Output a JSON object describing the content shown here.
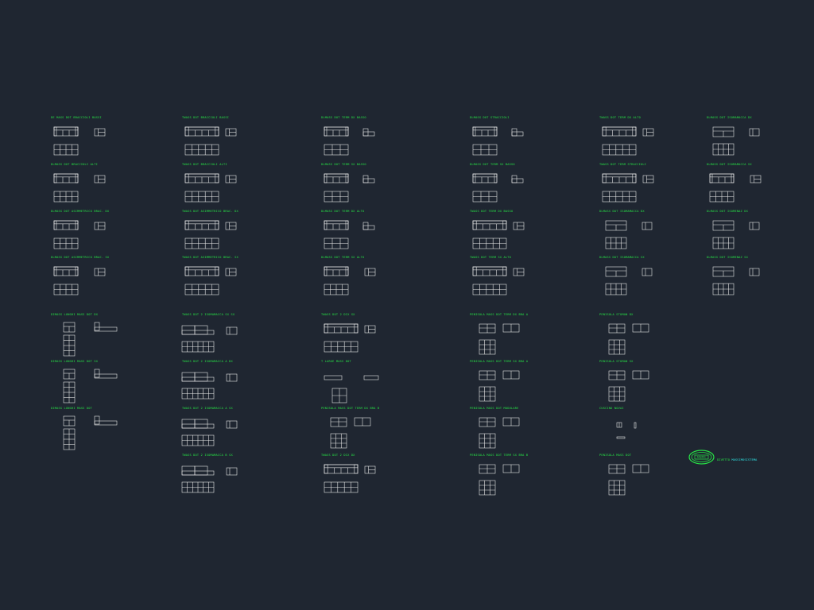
{
  "colors": {
    "background": "#1f2631",
    "label": "#27e646",
    "line": "#e6e6e6",
    "accent": "#2ee0e0"
  },
  "blocks": [
    {
      "label": "DE MASS DOT BRACCIOLI BASSI",
      "kind": "sofa"
    },
    {
      "label": "TWASS DOT BRACCIOLI BASSI",
      "kind": "sofa-wide"
    },
    {
      "label": "DLMASS DOT TERM DX BASSO",
      "kind": "sofa-end"
    },
    {
      "label": "DLMASS DOT STRACCIOLI",
      "kind": "sofa-end"
    },
    {
      "label": "TWASS DOT TERM DX ALTO",
      "kind": "sofa-wide"
    },
    {
      "label": "DLMASS DOT ISOMAMACCA DX",
      "kind": "corner"
    },
    {
      "label": "DLMASS DOT BRACCIOLI ALTI",
      "kind": "sofa"
    },
    {
      "label": "TWASS DOT BRACCIOLI ALTI",
      "kind": "sofa-wide"
    },
    {
      "label": "DLMASS DOT TERM SX BASSO",
      "kind": "sofa-end"
    },
    {
      "label": "DLMASS DOT TERM SX BASSO",
      "kind": "sofa-end"
    },
    {
      "label": "TWASS DOT TERM STRACCIOLI",
      "kind": "sofa-wide"
    },
    {
      "label": "DLMASS DOT ISOMAMACCA SX",
      "kind": "sofa"
    },
    {
      "label": "DLMASS DOT ASIMMETRICO BRAC. DX",
      "kind": "sofa"
    },
    {
      "label": "TWASS DOT ASIMMETRICO BRAC. DX",
      "kind": "sofa-wide"
    },
    {
      "label": "DLMASS DOT TERM DX ALTO",
      "kind": "sofa-end"
    },
    {
      "label": "TWASS DOT TERM DX BASSO",
      "kind": "sofa-wide"
    },
    {
      "label": "DLMASS DOT ISOMAMACCA DX",
      "kind": "corner"
    },
    {
      "label": "DLMASS DOT ISOMENAZ DX",
      "kind": "corner"
    },
    {
      "label": "DLMASS DOT ASIMMETRICO BRAC. SX",
      "kind": "sofa"
    },
    {
      "label": "TWASS DOT ASIMMETRICO BRAC. SX",
      "kind": "sofa-wide"
    },
    {
      "label": "DLMASS DOT TERM SX ALTO",
      "kind": "sofa"
    },
    {
      "label": "TWASS DOT TERM SX ALTO",
      "kind": "sofa-wide"
    },
    {
      "label": "DLMASS DOT ISOMAMACCA SX",
      "kind": "corner"
    },
    {
      "label": "DLMASS DOT ISOMENAZ SX",
      "kind": "corner"
    },
    {
      "label": "DIMASS LUNGHI MASS DOT DX",
      "kind": "long"
    },
    {
      "label": "TWASS DOT 2 ISOMAMACCA SX SX",
      "kind": "corner-wide"
    },
    {
      "label": "TWASS DOT 2 DIX SX",
      "kind": "sofa-wide"
    },
    {
      "label": "PENISOLA MASS DOT TERM DX BRA A",
      "kind": "grid"
    },
    {
      "label": "PENISOLA STUMAN DX",
      "kind": "grid"
    },
    {
      "label": "DIMASS LUNGHI MASS DOT SX",
      "kind": "long"
    },
    {
      "label": "TWASS DOT 2 ISOMAMACCA A DX",
      "kind": "corner-wide"
    },
    {
      "label": "T LARGE MASS DOT",
      "kind": "square"
    },
    {
      "label": "PENISOLA MASS DOT TERM SX BRA A",
      "kind": "grid"
    },
    {
      "label": "PENISOLA STUMAN SX",
      "kind": "grid"
    },
    {
      "label": "DIMASS LUNGHI MASS DOT",
      "kind": "long"
    },
    {
      "label": "TWASS DOT 2 ISOMAMACCA A SX",
      "kind": "corner-wide"
    },
    {
      "label": "PENISOLA MASS DOT TERM DX BRA B",
      "kind": "grid"
    },
    {
      "label": "PENISOLA MASS DOT MODULARE",
      "kind": "grid"
    },
    {
      "label": "CUSCINO NOVAI",
      "kind": "cushion"
    },
    {
      "label": "TWASS DOT 2 ISOMAMACCA B SX",
      "kind": "corner-wide"
    },
    {
      "label": "TWASS DOT 2 DIX DX",
      "kind": "sofa-wide"
    },
    {
      "label": "PENISOLA MASS DOT TERM SX BRA B",
      "kind": "grid"
    },
    {
      "label": "PENISOLA MASS DOT",
      "kind": "grid"
    },
    {
      "label": "CUSCINO SCHIENALE XX",
      "kind": "cushion"
    }
  ],
  "logo": {
    "emblem": "FABRIC",
    "prefix": "DIVETTO",
    "name": "MASSIMOSISTEMA"
  }
}
